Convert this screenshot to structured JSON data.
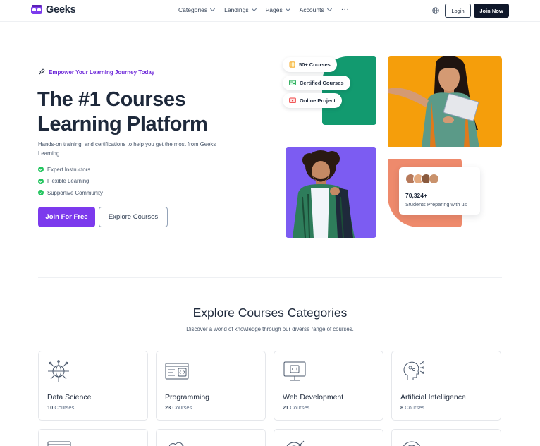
{
  "nav": {
    "brand": "Geeks",
    "menu": [
      {
        "label": "Categories"
      },
      {
        "label": "Landings"
      },
      {
        "label": "Pages"
      },
      {
        "label": "Accounts"
      }
    ],
    "more": "···",
    "login": "Login",
    "join": "Join Now"
  },
  "hero": {
    "tagline": "Empower Your Learning Journey Today",
    "title_line1": "The #1 Courses",
    "title_line2": "Learning Platform",
    "description": "Hands-on training, and certifications to help you get the most from Geeks Learning.",
    "features": [
      "Expert Instructors",
      "Flexible Learning",
      "Supportive Community"
    ],
    "primary_cta": "Join For Free",
    "secondary_cta": "Explore Courses"
  },
  "hero_visual": {
    "pills": [
      "50+ Courses",
      "Certified Courses",
      "Online Project"
    ],
    "stat_number": "70,324+",
    "stat_label": "Students Preparing with us"
  },
  "categories": {
    "title": "Explore Courses Categories",
    "subtitle": "Discover a world of knowledge through our diverse range of courses.",
    "items": [
      {
        "name": "Data Science",
        "count": "10",
        "unit": " Courses",
        "icon": "network-globe-icon"
      },
      {
        "name": "Programming",
        "count": "23",
        "unit": " Courses",
        "icon": "code-window-icon"
      },
      {
        "name": "Web Development",
        "count": "21",
        "unit": " Courses",
        "icon": "monitor-code-icon"
      },
      {
        "name": "Artificial Intelligence",
        "count": "8",
        "unit": " Courses",
        "icon": "ai-brain-icon"
      }
    ]
  },
  "colors": {
    "accent": "#7c3aed",
    "green": "#129a6f",
    "orange": "#f59e0b",
    "purple_card": "#7c5cf2",
    "salmon": "#ee8a6c",
    "dark": "#0f172a"
  }
}
